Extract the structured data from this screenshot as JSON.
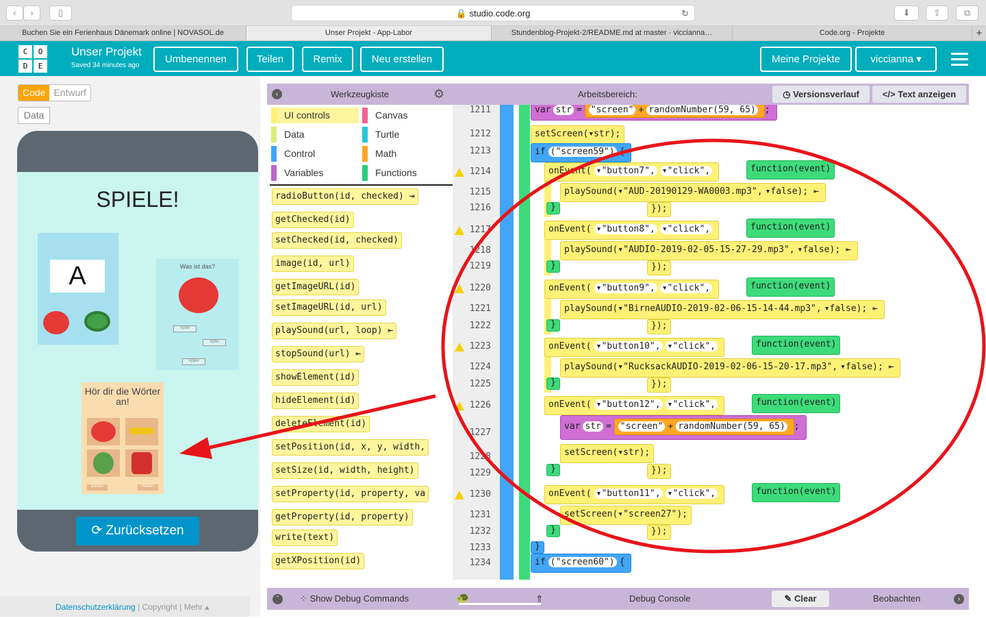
{
  "browser": {
    "url": "studio.code.org",
    "tabs": [
      "Buchen Sie ein Ferienhaus Dänemark online | NOVASOL.de",
      "Unser Projekt - App-Labor",
      "Stundenblog-Projekt-2/README.md at master · viccianna…",
      "Code.org - Projekte"
    ]
  },
  "header": {
    "logo": [
      "C",
      "O",
      "D",
      "E"
    ],
    "title": "Unser Projekt",
    "saved": "Saved 34 minutes ago",
    "buttons": [
      "Umbenennen",
      "Teilen",
      "Remix",
      "Neu erstellen"
    ],
    "my_projects": "Meine Projekte",
    "user": "viccianna"
  },
  "left": {
    "toggle_code": "Code",
    "toggle_design": "Entwurf",
    "data_button": "Data",
    "app_title": "SPIELE!",
    "card1_letter": "A",
    "card2_title": "Was ist das?",
    "card2_options": [
      "Apfel",
      "Apfel",
      "Appel"
    ],
    "card3_title": "Hör dir die Wörter an!",
    "card3_labels": [
      "Apfel",
      "Banane",
      "Birne",
      "Rucksack"
    ],
    "card3_nav": [
      "Zurück",
      "Weiter"
    ],
    "reset": "Zurücksetzen"
  },
  "footer": {
    "privacy": "Datenschutzerklärung",
    "copyright": "Copyright",
    "more": "Mehr ▴"
  },
  "toolbox": {
    "title": "Werkzeugkiste",
    "categories": [
      {
        "name": "UI controls",
        "color": "#fff176"
      },
      {
        "name": "Canvas",
        "color": "#f06292"
      },
      {
        "name": "Data",
        "color": "#dcec7a"
      },
      {
        "name": "Turtle",
        "color": "#26c6da"
      },
      {
        "name": "Control",
        "color": "#42a5f5"
      },
      {
        "name": "Math",
        "color": "#ffa726"
      },
      {
        "name": "Variables",
        "color": "#ba68c8"
      },
      {
        "name": "Functions",
        "color": "#26d07c"
      }
    ],
    "blocks": [
      "radioButton(id, checked) ⇥",
      "getChecked(id)",
      "setChecked(id, checked)",
      "image(id, url)",
      "getImageURL(id)",
      "setImageURL(id, url)",
      "playSound(url, loop) ⇤",
      "stopSound(url) ⇤",
      "showElement(id)",
      "hideElement(id)",
      "deleteElement(id)",
      "setPosition(id, x, y, width,",
      "setSize(id, width, height)",
      "setProperty(id, property, va",
      "getProperty(id, property)",
      "write(text)",
      "getXPosition(id)"
    ]
  },
  "workspace": {
    "title": "Arbeitsbereich:",
    "version_history": "Versionsverlauf",
    "show_text": "Text anzeigen",
    "lines": [
      "1211",
      "1212",
      "1213",
      "1214",
      "1215",
      "1216",
      "1217",
      "1218",
      "1219",
      "1220",
      "1221",
      "1222",
      "1223",
      "1224",
      "1225",
      "1226",
      "1227",
      "1228",
      "1229",
      "1230",
      "1231",
      "1232",
      "1233",
      "1234"
    ],
    "code": {
      "l1211": [
        "var",
        "str",
        "=",
        "\"screen\"",
        "+",
        "randomNumber(59, 65)",
        ";"
      ],
      "l1212": "setScreen(▾str);",
      "l1213": [
        "if",
        "(\"screen59\")",
        "{"
      ],
      "events": [
        {
          "btn": "▾\"button7\",",
          "click": "▾\"click\",",
          "fn": "function(event)",
          "sound": "playSound(▾\"AUD-20190129-WA0003.mp3\",",
          "loop": "▾false); ⇤"
        },
        {
          "btn": "▾\"button8\",",
          "click": "▾\"click\",",
          "fn": "function(event)",
          "sound": "playSound(▾\"AUDIO-2019-02-05-15-27-29.mp3\",",
          "loop": "▾false); ⇤"
        },
        {
          "btn": "▾\"button9\",",
          "click": "▾\"click\",",
          "fn": "function(event)",
          "sound": "playSound(▾\"BirneAUDIO-2019-02-06-15-14-44.mp3\",",
          "loop": "▾false); ⇤"
        },
        {
          "btn": "▾\"button10\",",
          "click": "▾\"click\",",
          "fn": "function(event)",
          "sound": "playSound(▾\"RucksackAUDIO-2019-02-06-15-20-17.mp3\",",
          "loop": "▾false); ⇤"
        }
      ],
      "ev12": {
        "btn": "▾\"button12\",",
        "click": "▾\"click\",",
        "fn": "function(event)",
        "var": [
          "var",
          "str",
          "=",
          "\"screen\"",
          "+",
          "randomNumber(59, 65)",
          ";"
        ],
        "screen": "setScreen(▾str);"
      },
      "ev11": {
        "btn": "▾\"button11\",",
        "click": "▾\"click\",",
        "fn": "function(event)",
        "screen": "setScreen(▾\"screen27\");"
      },
      "l1234": [
        "if",
        "(\"screen60\")",
        "{"
      ],
      "onEvent": "onEvent(",
      "close": "});",
      "brace": "}"
    }
  },
  "debug": {
    "show_cmds": "Show Debug Commands",
    "console": "Debug Console",
    "clear": "Clear",
    "watch": "Beobachten"
  }
}
